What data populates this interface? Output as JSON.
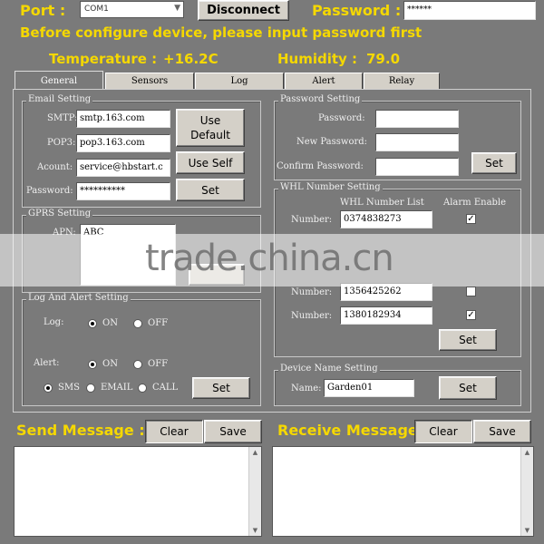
{
  "header": {
    "port_label": "Port :",
    "port_value": "COM1",
    "disconnect_label": "Disconnect",
    "password_label": "Password :",
    "password_value": "******",
    "notice": "Before configure device, please input password first",
    "temperature_label": "Temperature :",
    "temperature_value": "+16.2C",
    "humidity_label": "Humidity :",
    "humidity_value": "79.0"
  },
  "tabs": [
    "General",
    "Sensors",
    "Log",
    "Alert",
    "Relay"
  ],
  "email": {
    "title": "Email Setting",
    "smtp_label": "SMTP:",
    "smtp_value": "smtp.163.com",
    "pop3_label": "POP3:",
    "pop3_value": "pop3.163.com",
    "account_label": "Acount:",
    "account_value": "service@hbstart.c",
    "password_label": "Password:",
    "password_value": "**********",
    "use_default": "Use Default",
    "use_self": "Use Self",
    "set": "Set"
  },
  "gprs": {
    "title": "GPRS Setting",
    "apn_label": "APN:",
    "apn_value": "ABC"
  },
  "log_alert": {
    "title": "Log And Alert Setting",
    "log_label": "Log:",
    "on": "ON",
    "off": "OFF",
    "alert_label": "Alert:",
    "sms": "SMS",
    "email": "EMAIL",
    "call": "CALL",
    "set": "Set"
  },
  "password_setting": {
    "title": "Password Setting",
    "password_label": "Password:",
    "new_password_label": "New Password:",
    "confirm_label": "Confirm Password:",
    "set": "Set"
  },
  "whl": {
    "title": "WHL Number Setting",
    "list_header": "WHL Number List",
    "alarm_header": "Alarm Enable",
    "number_label": "Number:",
    "rows": [
      {
        "number": "0374838273",
        "alarm": true
      },
      {
        "number": "1356425262",
        "alarm": false
      },
      {
        "number": "1380182934",
        "alarm": true
      }
    ],
    "set": "Set"
  },
  "device_name": {
    "title": "Device Name Setting",
    "name_label": "Name:",
    "name_value": "Garden01",
    "set": "Set"
  },
  "send": {
    "title": "Send Message :",
    "clear": "Clear",
    "save": "Save"
  },
  "receive": {
    "title": "Receive Message :",
    "clear": "Clear",
    "save": "Save"
  },
  "watermark": "trade.china.cn",
  "colors": {
    "background": "#7a7a7a",
    "accent_text": "#f5d800",
    "button_face": "#d4d0c8"
  }
}
